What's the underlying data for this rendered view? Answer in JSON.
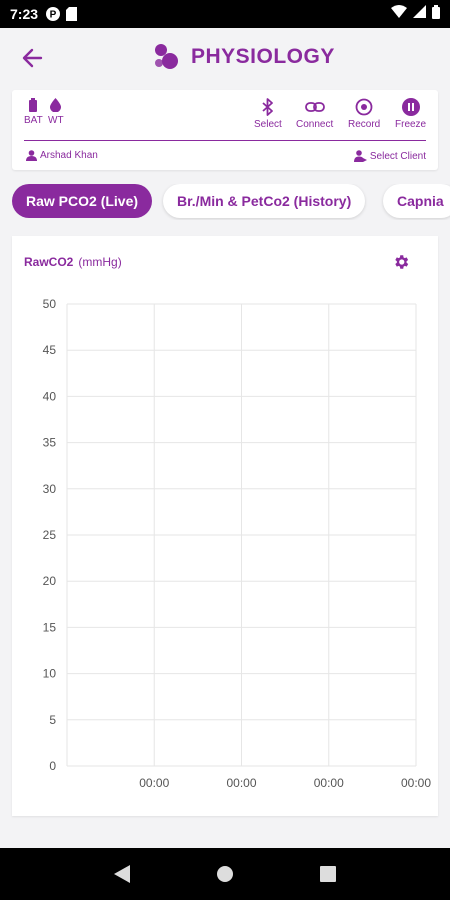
{
  "status": {
    "time": "7:23"
  },
  "header": {
    "title": "PHYSIOLOGY"
  },
  "device": {
    "battery_label": "BAT",
    "weight_label": "WT",
    "actions": [
      {
        "label": "Select",
        "icon": "bluetooth-icon"
      },
      {
        "label": "Connect",
        "icon": "link-icon"
      },
      {
        "label": "Record",
        "icon": "record-icon"
      },
      {
        "label": "Freeze",
        "icon": "pause-icon"
      }
    ],
    "client_name": "Arshad Khan",
    "select_client_label": "Select Client"
  },
  "tabs": [
    {
      "label": "Raw PCO2 (Live)",
      "active": true
    },
    {
      "label": "Br./Min & PetCo2 (History)",
      "active": false
    },
    {
      "label": "Capnia",
      "active": false
    }
  ],
  "chart": {
    "title": "RawCO2",
    "unit": "(mmHg)"
  },
  "chart_data": {
    "type": "line",
    "title": "RawCO2",
    "ylabel": "(mmHg)",
    "xlabel": "",
    "ylim": [
      0,
      50
    ],
    "y_ticks": [
      0,
      5,
      10,
      15,
      20,
      25,
      30,
      35,
      40,
      45,
      50
    ],
    "x_tick_labels": [
      "00:00",
      "00:00",
      "00:00",
      "00:00"
    ],
    "series": [],
    "grid": true
  },
  "colors": {
    "accent": "#8a2a9e",
    "grid": "#e6e6e6",
    "axis_text": "#555555"
  }
}
